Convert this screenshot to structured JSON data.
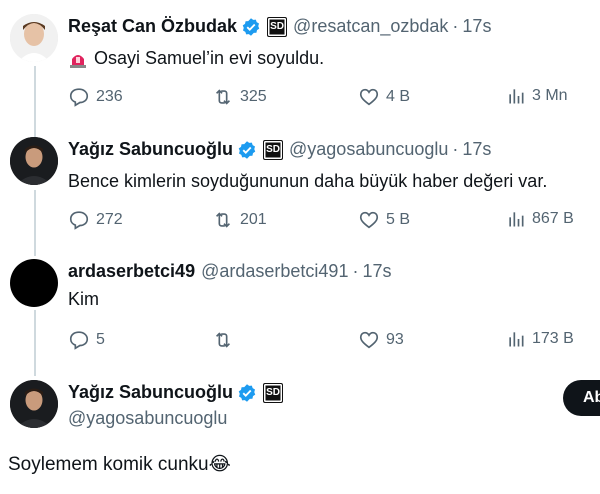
{
  "tweets": [
    {
      "name": "Reşat Can Özbudak",
      "handle": "@resatcan_ozbdak",
      "time": "17s",
      "badge": "SD",
      "text": "Osayi Samuel’in evi soyuldu.",
      "emoji_icon": "police-siren",
      "replies": "236",
      "retweets": "325",
      "likes": "4 B",
      "views": "3 Mn"
    },
    {
      "name": "Yağız Sabuncuoğlu",
      "handle": "@yagosabuncuoglu",
      "time": "17s",
      "badge": "SD",
      "text": "Bence kimlerin soyduğununun daha büyük haber değeri var.",
      "replies": "272",
      "retweets": "201",
      "likes": "5 B",
      "views": "867 B"
    },
    {
      "name": "ardaserbetci49",
      "handle": "@ardaserbetci491",
      "time": "17s",
      "text": "Kim",
      "replies": "5",
      "retweets": "",
      "likes": "93",
      "views": "173 B"
    },
    {
      "name": "Yağız Sabuncuoğlu",
      "handle": "@yagosabuncuoglu",
      "badge": "SD",
      "text": "Soylemem komik cunku😂"
    }
  ],
  "follow_button": {
    "label": "Ab"
  },
  "colors": {
    "verified": "#1d9bf0",
    "muted": "#536471",
    "text": "#0f1419",
    "thread_line": "#cfd9de"
  }
}
